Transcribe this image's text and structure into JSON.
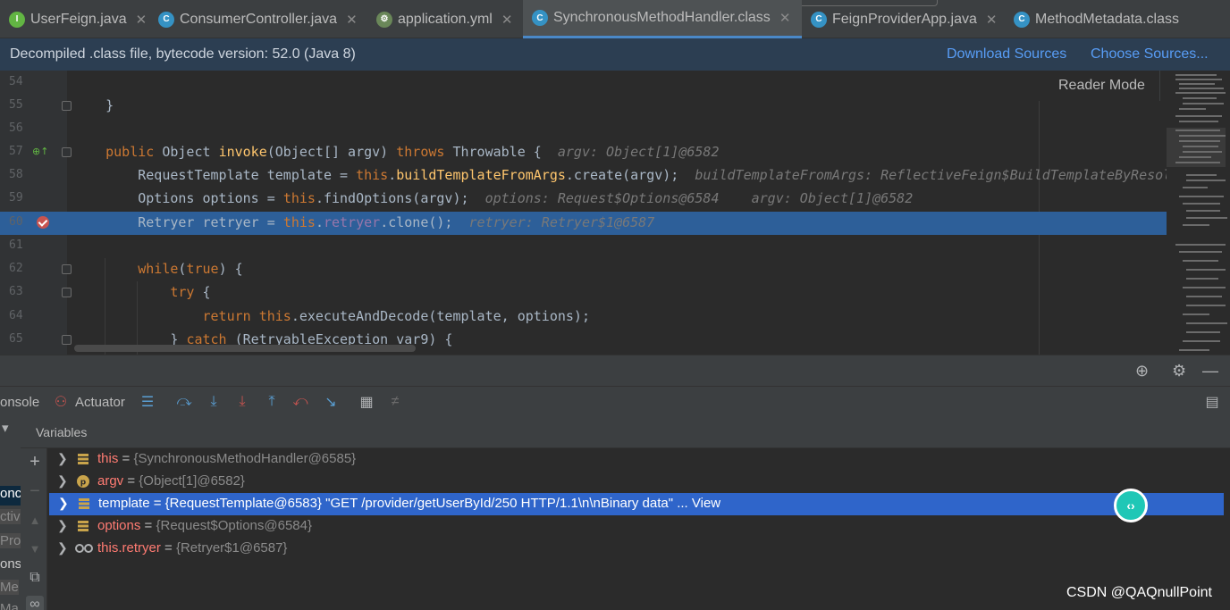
{
  "tabs": [
    {
      "label": "UserFeign.java",
      "icon": "interface-icon",
      "color": "#62b543"
    },
    {
      "label": "ConsumerController.java",
      "icon": "class-icon",
      "color": "#3592c4"
    },
    {
      "label": "application.yml",
      "icon": "yaml-icon",
      "color": "#6a8759"
    },
    {
      "label": "SynchronousMethodHandler.class",
      "icon": "class-file-icon",
      "color": "#3592c4"
    },
    {
      "label": "FeignProviderApp.java",
      "icon": "spring-class-icon",
      "color": "#3592c4"
    },
    {
      "label": "MethodMetadata.class",
      "icon": "class-file-icon",
      "color": "#3592c4"
    }
  ],
  "banner": {
    "message": "Decompiled .class file, bytecode version: 52.0 (Java 8)",
    "download_sources": "Download Sources",
    "choose_sources": "Choose Sources..."
  },
  "editor": {
    "reader_mode": "Reader Mode",
    "lines": [
      {
        "num": "54"
      },
      {
        "num": "55",
        "text": "    }"
      },
      {
        "num": "56"
      },
      {
        "num": "57",
        "sig": {
          "kw_public": "public",
          "type1": " Object ",
          "method": "invoke",
          "params": "(Object[] argv) ",
          "kw_throws": "throws",
          "tail": " Throwable {",
          "hint": "argv: Object[1]@6582"
        }
      },
      {
        "num": "58",
        "l58": {
          "pre": "        RequestTemplate template = ",
          "kw": "this",
          "dot": ".",
          "method": "buildTemplateFromArgs",
          "tail": ".create(argv);",
          "hint": "buildTemplateFromArgs: ReflectiveFeign$BuildTemplateByResol"
        }
      },
      {
        "num": "59",
        "l59": {
          "pre": "        Options options = ",
          "kw": "this",
          "tail": ".findOptions(argv);",
          "hint": "options: Request$Options@6584    argv: Object[1]@6582"
        }
      },
      {
        "num": "60",
        "l60": {
          "pre": "        Retryer retryer = ",
          "kw": "this",
          "dot": ".",
          "field": "retryer",
          "tail": ".clone();",
          "hint": "retryer: Retryer$1@6587"
        }
      },
      {
        "num": "61"
      },
      {
        "num": "62",
        "l62": {
          "pre": "        ",
          "kw": "while",
          "open": "(",
          "kw2": "true",
          "tail": ") {"
        }
      },
      {
        "num": "63",
        "l63": {
          "pre": "            ",
          "kw": "try",
          "tail": " {"
        }
      },
      {
        "num": "64",
        "l64": {
          "pre": "                ",
          "kw": "return",
          "sp": " ",
          "kw2": "this",
          "tail": ".executeAndDecode(template, options);"
        }
      },
      {
        "num": "65",
        "l65": {
          "pre": "            } ",
          "kw": "catch",
          "tail": " (RetryableException var9) {"
        }
      }
    ]
  },
  "debugger": {
    "console_tab": "onsole",
    "actuator_tab": "Actuator",
    "variables_title": "Variables",
    "left_strip": [
      "onc",
      "ctiv",
      "Pro",
      "ons",
      "Me",
      "Ma"
    ],
    "variables": [
      {
        "name": "this",
        "eq": " = ",
        "value": "{SynchronousMethodHandler@6585}",
        "icon": "field-icon"
      },
      {
        "name": "argv",
        "eq": " = ",
        "value": "{Object[1]@6582}",
        "icon": "parameter-icon"
      },
      {
        "name": "template",
        "eq": " = ",
        "value": "{RequestTemplate@6583} \"GET /provider/getUserById/250 HTTP/1.1\\n\\nBinary data\" ...",
        "view": " View",
        "icon": "field-icon",
        "selected": true
      },
      {
        "name": "options",
        "eq": " = ",
        "value": "{Request$Options@6584}",
        "icon": "field-icon"
      },
      {
        "name": "this.retryer",
        "eq": " = ",
        "value": "{Retryer$1@6587}",
        "icon": "watch-icon"
      }
    ]
  },
  "watermark": "CSDN @QAQnullPoint",
  "colors": {
    "accent": "#2f65ca",
    "highlight_line": "#2d5f99",
    "keyword": "#cc7832",
    "method": "#ffc66d",
    "field": "#9876aa",
    "link": "#589df6"
  }
}
